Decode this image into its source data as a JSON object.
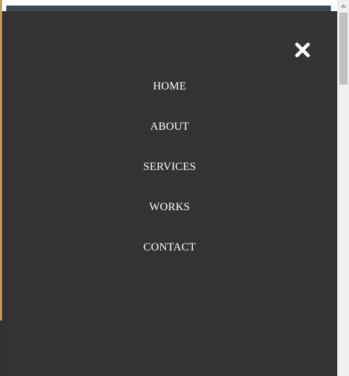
{
  "menu": {
    "close_icon": "close-icon",
    "items": [
      {
        "label": "HOME"
      },
      {
        "label": "ABOUT"
      },
      {
        "label": "SERVICES"
      },
      {
        "label": "WORKS"
      },
      {
        "label": "CONTACT"
      }
    ]
  },
  "colors": {
    "overlay_bg": "#333333",
    "menu_text": "#ffffff",
    "header_strip": "#3b4a58",
    "page_accent": "#c89a56"
  },
  "scrollbar": {
    "up_icon": "scroll-up-arrow-icon"
  }
}
